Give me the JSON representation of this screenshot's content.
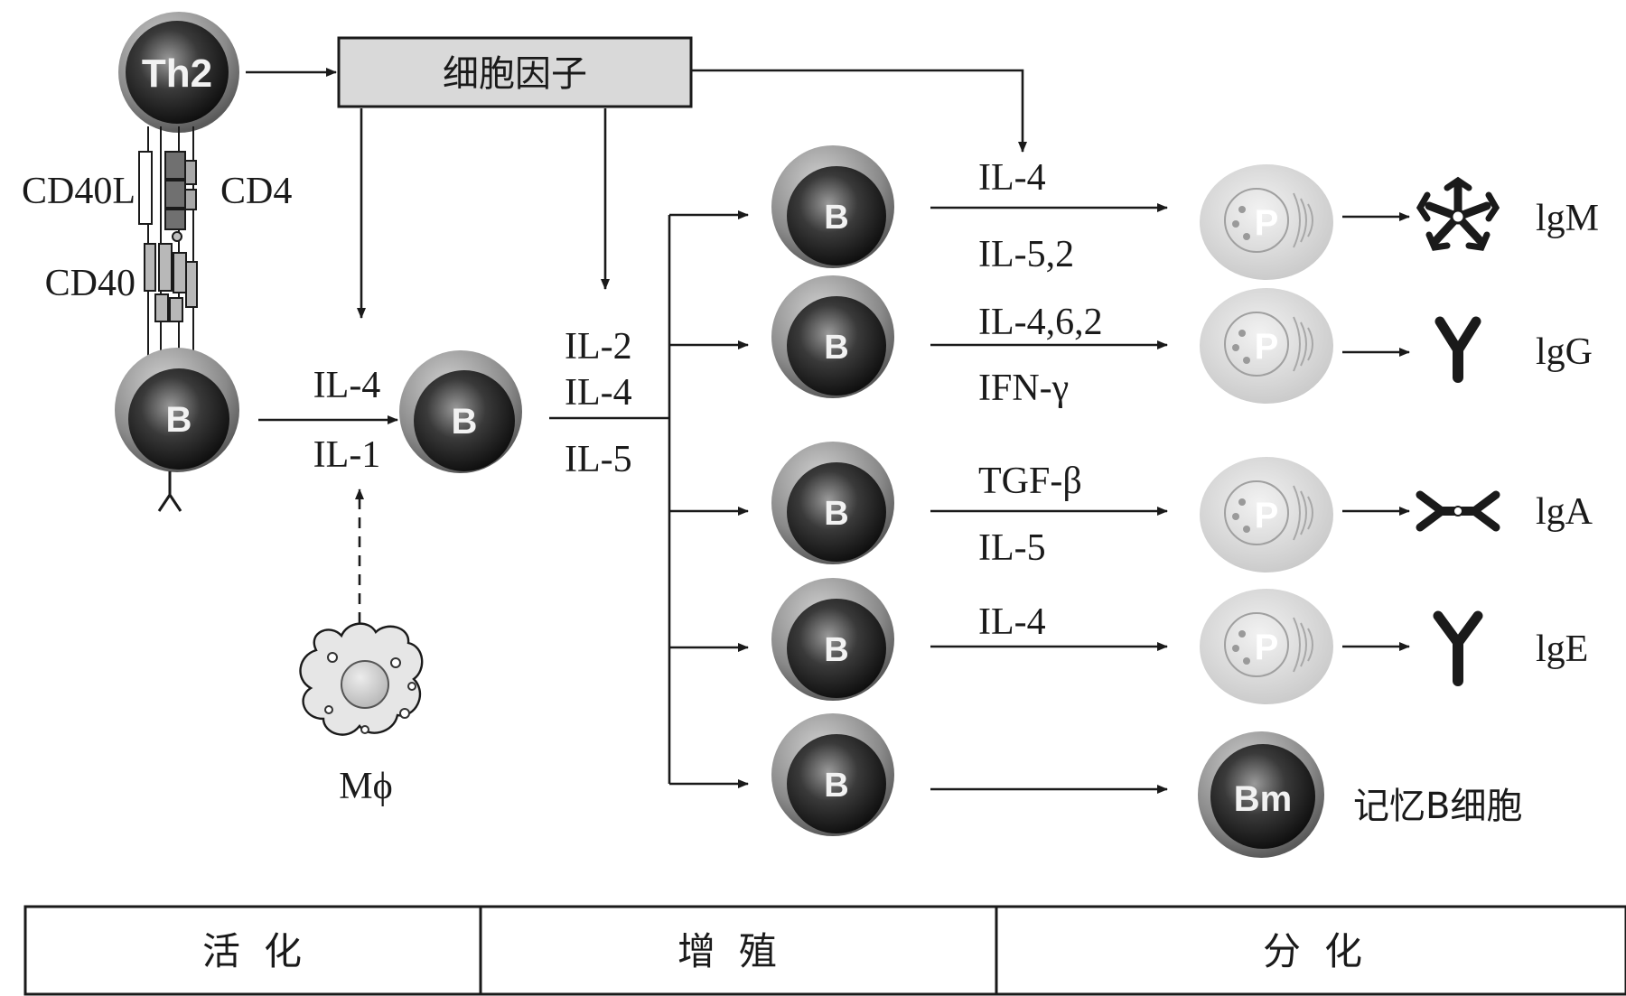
{
  "cytokine_box": {
    "label": "细胞因子",
    "fill": "#d9d9d9"
  },
  "cells": {
    "th2": "Th2",
    "b": "B",
    "plasma": "P",
    "memory": "Bm"
  },
  "receptors": {
    "cd40l": "CD40L",
    "cd4": "CD4",
    "cd40": "CD40"
  },
  "activation": {
    "signal_top": "IL-4",
    "signal_bottom": "IL-1",
    "macrophage": "Mϕ"
  },
  "proliferation": {
    "signals": [
      "IL-2",
      "IL-4",
      "IL-5"
    ]
  },
  "branches": [
    {
      "signal_top": "IL-4",
      "signal_bottom": "IL-5,2",
      "antibody": "lgM",
      "antibody_icon": "igm-pentamer-icon"
    },
    {
      "signal_top": "IL-4,6,2",
      "signal_bottom": "IFN-γ",
      "antibody": "lgG",
      "antibody_icon": "igg-monomer-icon"
    },
    {
      "signal_top": "TGF-β",
      "signal_bottom": "IL-5",
      "antibody": "lgA",
      "antibody_icon": "iga-dimer-icon"
    },
    {
      "signal_top": "IL-4",
      "signal_bottom": "",
      "antibody": "lgE",
      "antibody_icon": "ige-monomer-icon"
    }
  ],
  "memory_branch": {
    "label": "记忆B细胞"
  },
  "stages": [
    "活化",
    "增殖",
    "分化"
  ],
  "colors": {
    "b_cell_dark": "#2b2b2b",
    "b_cell_rim": "#8c8c8c",
    "plasma_cell": "#dedede",
    "macrophage": "#e6e6e6"
  }
}
